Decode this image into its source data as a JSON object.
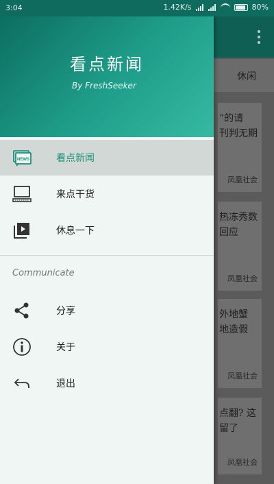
{
  "status_bar": {
    "time": "3:04",
    "net_speed": "1.42K/s",
    "battery": "80%"
  },
  "drawer": {
    "title": "看点新闻",
    "subtitle": "By FreshSeeker",
    "items": [
      {
        "label": "看点新闻",
        "icon": "news-icon",
        "active": true
      },
      {
        "label": "来点干货",
        "icon": "computer-icon",
        "active": false
      },
      {
        "label": "休息一下",
        "icon": "video-library-icon",
        "active": false
      }
    ],
    "section_title": "Communicate",
    "section_items": [
      {
        "label": "分享",
        "icon": "share-icon"
      },
      {
        "label": "关于",
        "icon": "info-icon"
      },
      {
        "label": "退出",
        "icon": "back-arrow-icon"
      }
    ]
  },
  "background": {
    "tab_label": "休闲",
    "cards": [
      {
        "title": "”的请\n刊判无期",
        "source": "凤凰社会"
      },
      {
        "title": "热冻秀数\n回应",
        "source": "凤凰社会"
      },
      {
        "title": "外地蟹\n地造假",
        "source": "凤凰社会"
      },
      {
        "title": "点翻? 这\n留了",
        "source": "凤凰社会"
      }
    ],
    "accent": "#0f5f54"
  },
  "colors": {
    "accent": "#1d8f7b",
    "header_start": "#0d6e60",
    "header_end": "#36b9a3",
    "drawer_bg": "#eff6f4"
  }
}
